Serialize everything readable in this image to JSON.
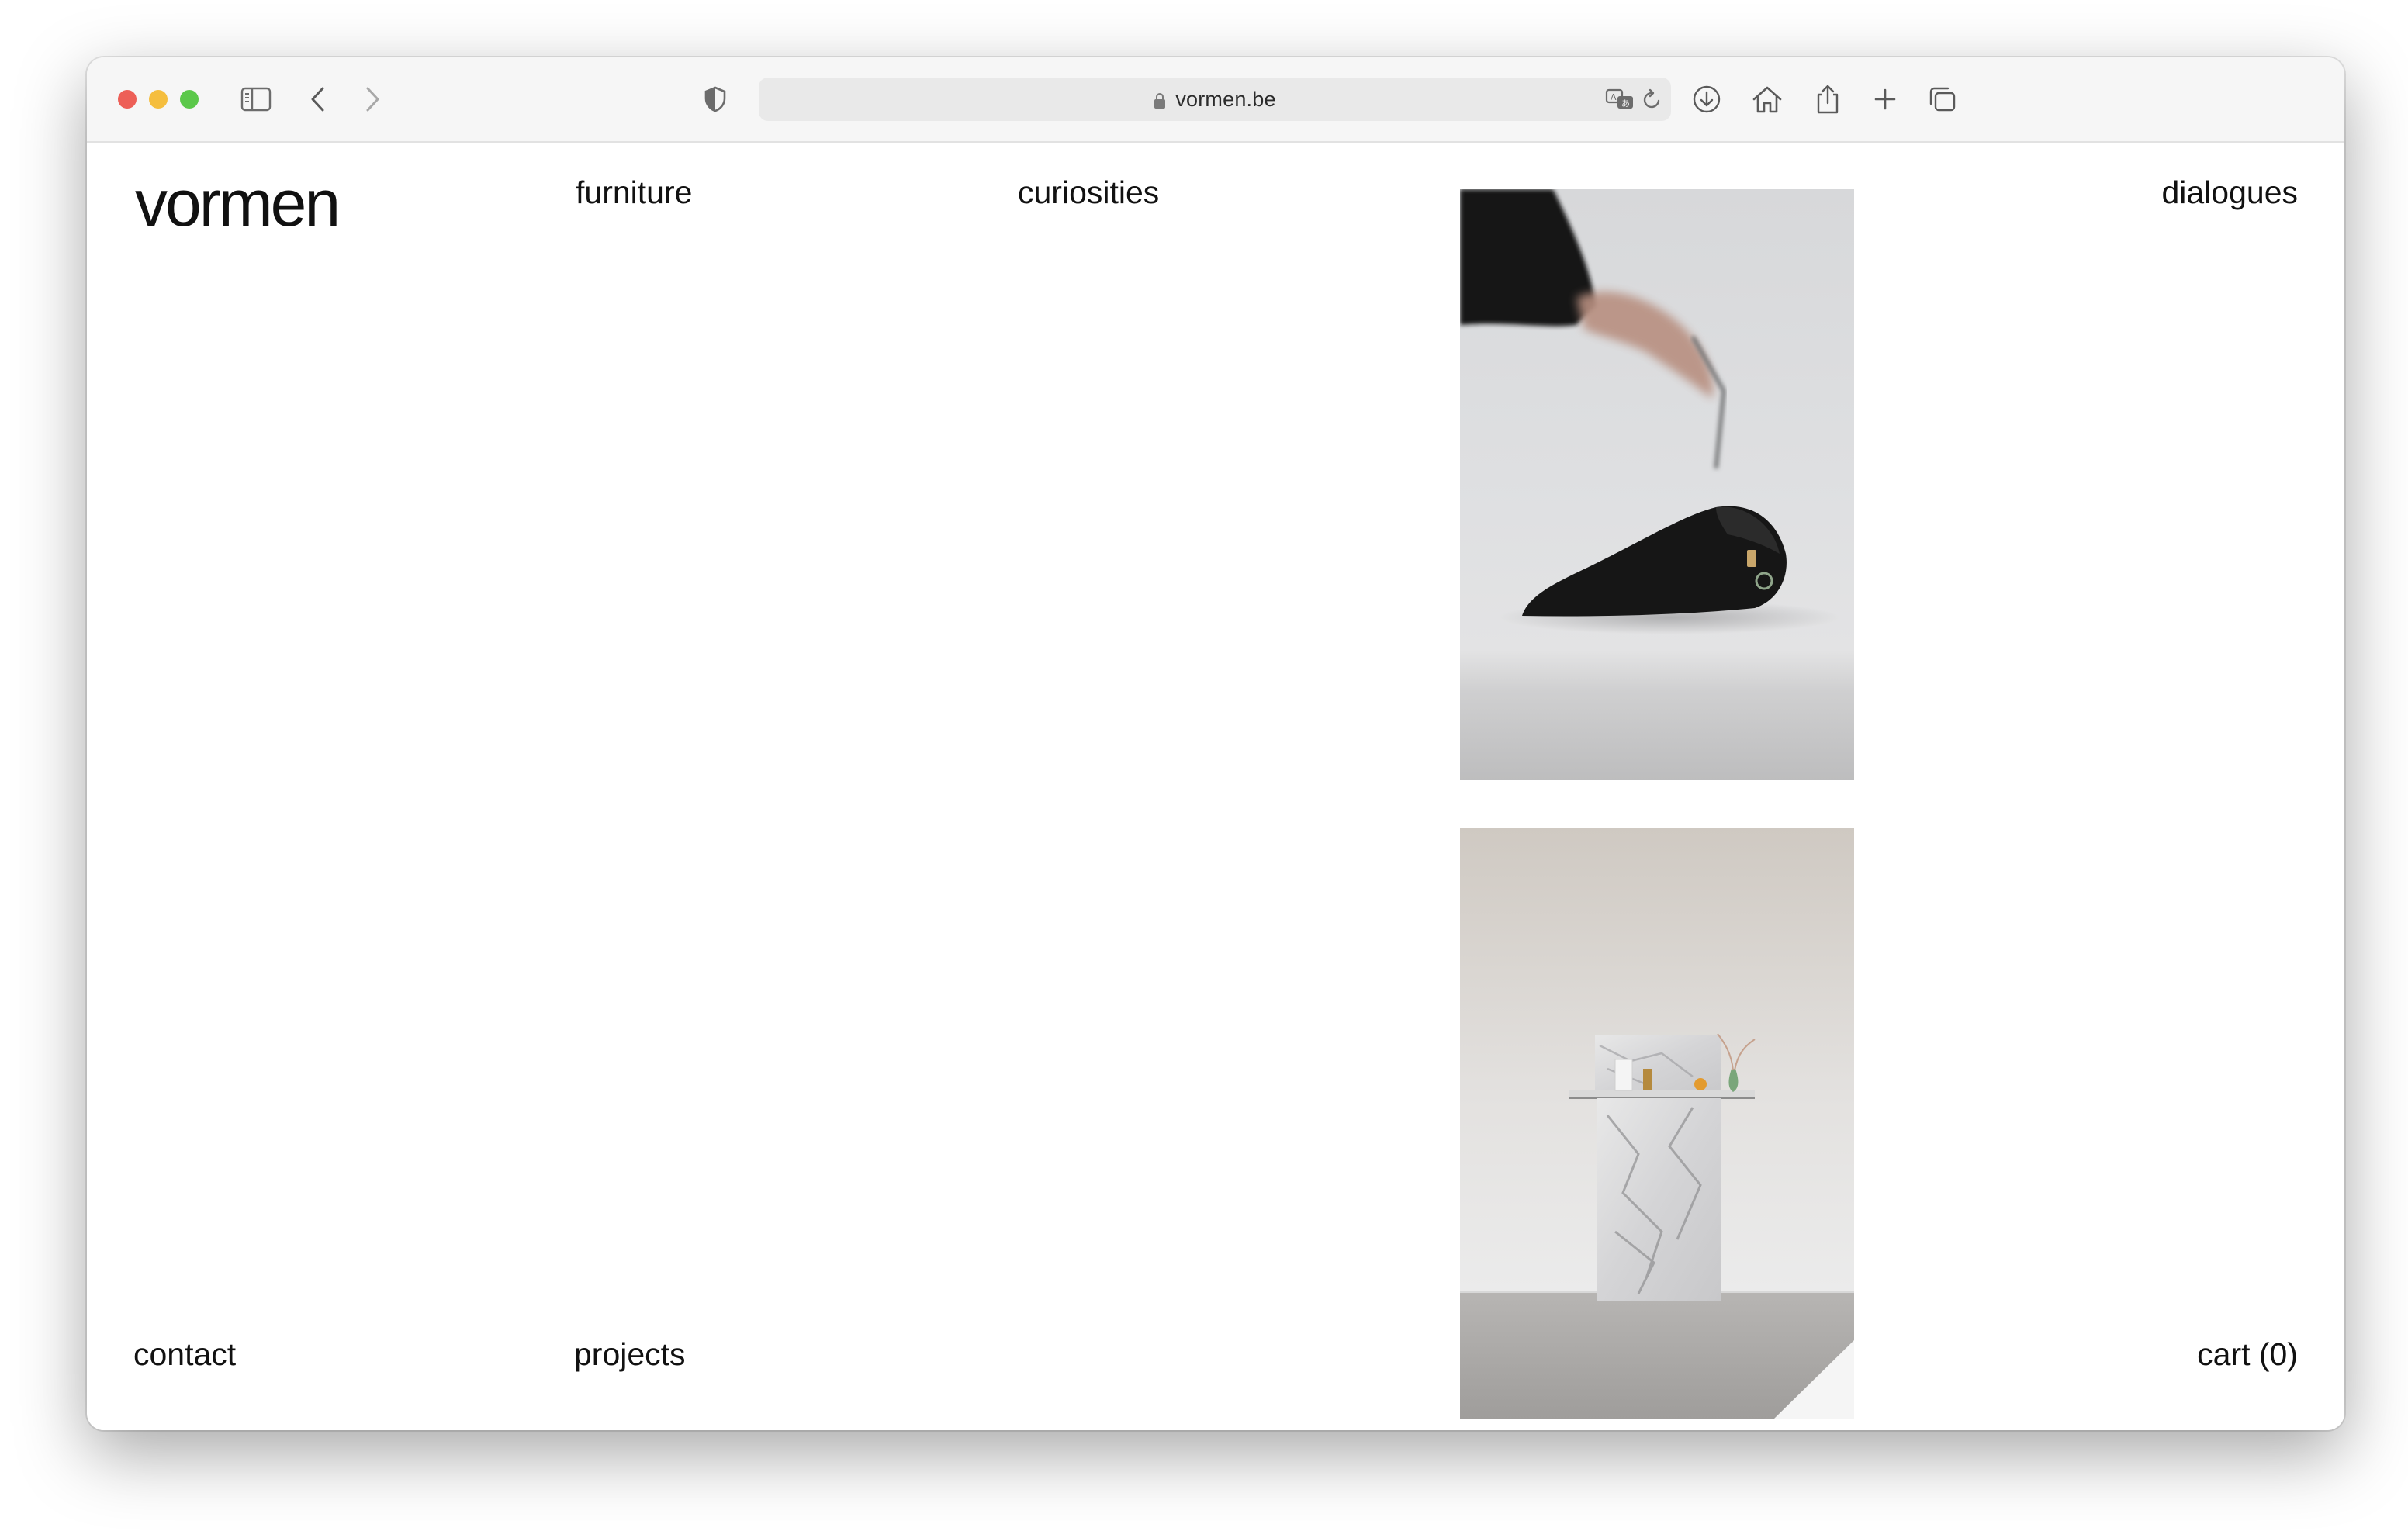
{
  "browser": {
    "url": "vormen.be",
    "icons": {
      "sidebar": "sidebar-icon",
      "back": "chevron-left-icon",
      "forward": "chevron-right-icon",
      "privacy": "shield-icon",
      "translate": "translate-icon",
      "reload": "reload-icon",
      "downloads": "download-icon",
      "home": "home-icon",
      "share": "share-icon",
      "new_tab": "plus-icon",
      "tabs": "tabs-overview-icon"
    }
  },
  "site": {
    "logo": "vormen",
    "nav": {
      "furniture": "furniture",
      "curiosities": "curiosities",
      "dialogues": "dialogues",
      "contact": "contact",
      "projects": "projects",
      "cart": "cart (0)"
    }
  },
  "colors": {
    "text": "#111111",
    "background": "#ffffff",
    "toolbar": "#f6f6f6"
  }
}
